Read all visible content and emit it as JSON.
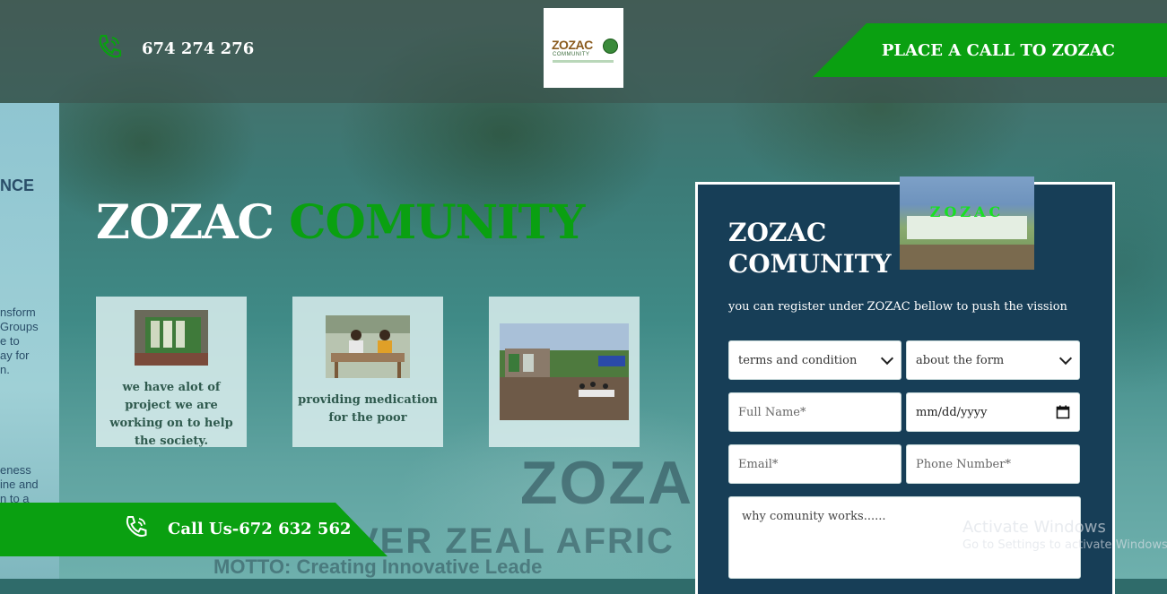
{
  "header": {
    "phone_number": "674 274 276",
    "logo": {
      "text": "ZOZAC",
      "subtext": "COMMUNITY"
    },
    "cta_label": "PLACE A CALL TO ZOZAC"
  },
  "hero": {
    "title_part1": "ZOZAC",
    "title_part2": "COMUNITY",
    "cards": [
      {
        "caption": "we have alot of project we are working on to help the society."
      },
      {
        "caption": "providing medication for the poor"
      },
      {
        "caption": ""
      }
    ],
    "call_us_label": "Call Us-672 632 562"
  },
  "form": {
    "title_line1": "ZOZAC",
    "title_line2": "COMUNITY",
    "photo_label": "ZOZAC",
    "subtitle": "you can register under ZOZAC bellow to push the vission",
    "select_terms": "terms and condition",
    "select_about": "about the form",
    "fullname_placeholder": "Full Name*",
    "date_placeholder": "mm/dd/yyyy",
    "email_placeholder": "Email*",
    "phone_placeholder": "Phone Number*",
    "message_placeholder": "why comunity works......"
  },
  "background": {
    "banner_left_lines": [
      "NCE",
      "nsform",
      "Groups",
      "e to",
      "ay for",
      "n.",
      "eness",
      "ine and",
      "n to a"
    ],
    "banner_logo": "ZOZAC",
    "banner_slogan": "ZEAL OVER ZEAL AFRICAN CO",
    "banner_zeal": "VER ZEAL AFRIC",
    "banner_motto": "MOTTO: Creating Innovative Leade"
  },
  "os_watermark": {
    "line1": "Activate Windows",
    "line2": "Go to Settings to activate Windows."
  },
  "colors": {
    "green": "#0aa011",
    "panel": "#173e57",
    "white": "#ffffff"
  },
  "icons": [
    "phone-icon",
    "phone-ringing-icon",
    "calendar-icon",
    "chevron-down-icon"
  ]
}
